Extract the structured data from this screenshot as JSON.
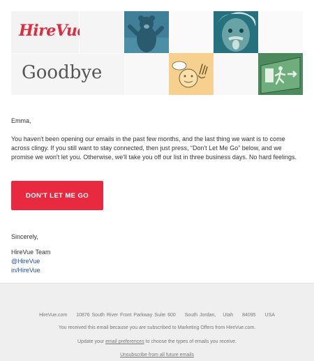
{
  "hero": {
    "logo_text": "HireVue",
    "heading": "Goodbye",
    "tiles": [
      "bear-photo",
      "einstein-photo",
      "waving-emoji-sketch",
      "exit-sign-photo"
    ],
    "colors": {
      "brand": "#e02a3d",
      "bear": "#3f7f98",
      "einstein": "#25717d",
      "emoji": "#f6d08e",
      "exit": "#4c8a5e"
    }
  },
  "body": {
    "greeting": "Emma,",
    "paragraph": "You haven't been opening our emails in the past few months, and the last thing we want is to come across clingy. If you still want to stay connected, then just press, “Don't Let Me Go” below, and we promise we won't let you. Otherwise, we'll take you off our list in three business days. No hard feelings.",
    "cta_label": "Don't Let Me Go",
    "signoff": "Sincerely,",
    "team": "HireVue Team",
    "twitter_link": "@HireVue",
    "linkedin_link": "in/HireVue"
  },
  "footer": {
    "company": "HireVue.com",
    "street": "10876 South River Front Parkway Suite 600",
    "city": "South Jordan,",
    "state": "Utah",
    "zip": "84095",
    "country": "USA",
    "reason": "You received this email because you are subscribed to Marketing Offers from HireVue.com.",
    "update_prefix": "Update your",
    "update_link": "email preferences",
    "update_suffix": "to choose the types of emails you receive.",
    "unsubscribe": "Unsubscribe from all future emails"
  }
}
